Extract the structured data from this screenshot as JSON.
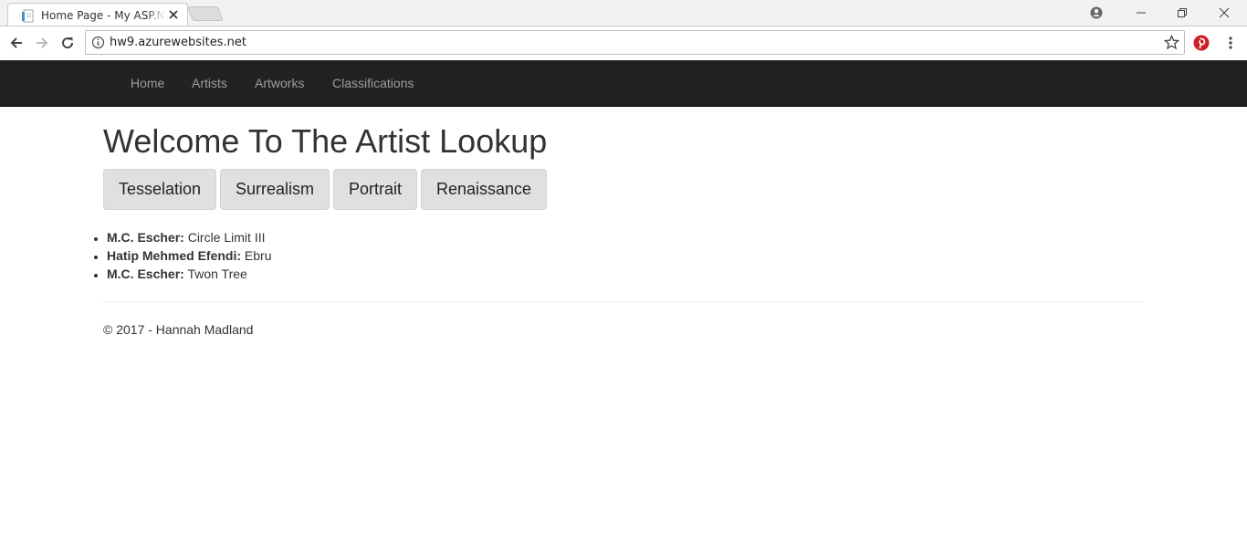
{
  "browser": {
    "tab_title": "Home Page - My ASP.NET Application",
    "url": "hw9.azurewebsites.net"
  },
  "navbar": {
    "links": [
      "Home",
      "Artists",
      "Artworks",
      "Classifications"
    ]
  },
  "main": {
    "title": "Welcome To The Artist Lookup",
    "categories": [
      "Tesselation",
      "Surrealism",
      "Portrait",
      "Renaissance"
    ],
    "artworks": [
      {
        "artist": "M.C. Escher:",
        "work": "Circle Limit III"
      },
      {
        "artist": "Hatip Mehmed Efendi:",
        "work": "Ebru"
      },
      {
        "artist": "M.C. Escher:",
        "work": "Twon Tree"
      }
    ]
  },
  "footer": {
    "text": "© 2017 - Hannah Madland"
  },
  "colors": {
    "navbar_bg": "#222222",
    "nav_link": "#9d9d9d",
    "button_bg": "#e0e0e0",
    "pinterest": "#cb2027"
  }
}
